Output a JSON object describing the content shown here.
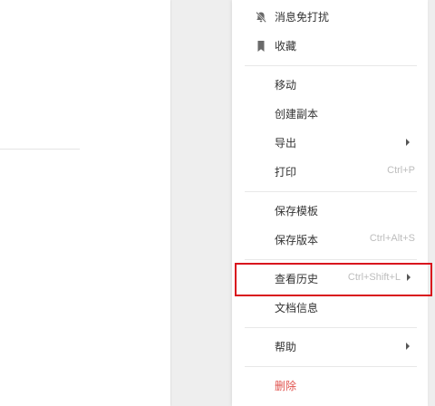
{
  "menu": {
    "mute": {
      "label": "消息免打扰",
      "icon": "bell-off-icon"
    },
    "favorite": {
      "label": "收藏",
      "icon": "bookmark-icon"
    },
    "move": {
      "label": "移动"
    },
    "copy": {
      "label": "创建副本"
    },
    "export": {
      "label": "导出"
    },
    "print": {
      "label": "打印",
      "shortcut": "Ctrl+P"
    },
    "save_template": {
      "label": "保存模板"
    },
    "save_version": {
      "label": "保存版本",
      "shortcut": "Ctrl+Alt+S"
    },
    "history": {
      "label": "查看历史",
      "shortcut": "Ctrl+Shift+L"
    },
    "doc_info": {
      "label": "文档信息"
    },
    "help": {
      "label": "帮助"
    },
    "delete": {
      "label": "删除"
    }
  },
  "colors": {
    "highlight_border": "#d9131d",
    "danger_text": "#e0524d",
    "shortcut_text": "#bdbdbd"
  }
}
